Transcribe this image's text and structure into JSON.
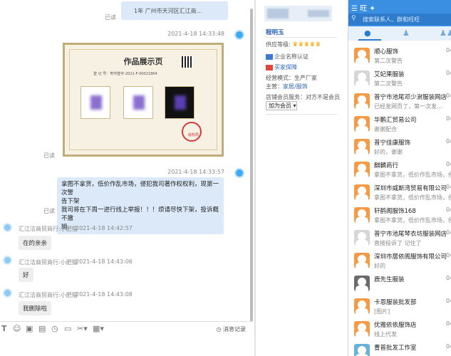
{
  "chat": {
    "top_card_text": "1年 广州市天河区汇江商…",
    "read_label": "已读",
    "messages": [
      {
        "time": "2021-4-18 14:33:48",
        "read": "已读"
      },
      {
        "time": "2021-4-18 14:33:57",
        "read": "已读",
        "text_lines": [
          "拿图不拿货，低价作乱市场，侵犯我司著作权权利，现第一次警",
          "告下架",
          "我司将在下周一进行线上举报！！！烦请尽快下架，投诉概不撤",
          "销"
        ]
      }
    ],
    "incoming": [
      {
        "sender": "汇江洁商贸商行:小肥猫",
        "time": "2021-4-18 14:42:57",
        "text": "在的亲亲"
      },
      {
        "sender": "汇江洁商贸商行:小肥猫",
        "time": "2021-4-18 14:43:06",
        "text": "好"
      },
      {
        "sender": "汇江洁商贸商行:小肥猫",
        "time": "2021-4-18 14:43:08",
        "text": "我删除啦"
      }
    ],
    "certificate": {
      "title": "作品展示页",
      "sub": "登 记 号：粤作登字-2021-F-00021864",
      "seal": "版权局"
    },
    "history_label": "消息记录"
  },
  "info": {
    "name": "程明玉",
    "level_label": "供应等级:",
    "enterprise": "企业名称认证",
    "buyer_protect": "买家保障",
    "model": "经营模式：生产厂家",
    "main_label": "主营：",
    "main_links": "家居/服饰",
    "member": "店铺会员服务：对方不是会员",
    "upgrade": "加为会员"
  },
  "right": {
    "search_placeholder": "搜索联系人、群和旺旺",
    "contacts": [
      {
        "name": "顺心服饰",
        "snippet": "第二次警告",
        "date": "04-"
      },
      {
        "name": "艾妃果服装",
        "snippet": "第二次警告",
        "date": "04-"
      },
      {
        "name": "普宁市池尾邓少澍服装网店",
        "snippet": "已经发网页了，第一次发…",
        "date": "04-"
      },
      {
        "name": "华鹏汇贸易公司",
        "snippet": "谢谢配合",
        "date": "04-"
      },
      {
        "name": "普宁佳康服饰",
        "snippet": "好的，谢谢",
        "date": "04-"
      },
      {
        "name": "麒麟商行",
        "snippet": "拿图不拿货，低价作乱市场，侵犯…",
        "date": "04-"
      },
      {
        "name": "深圳市威斯湾贸易有限公司",
        "snippet": "拿图不拿货，低价作乱市场，侵犯…",
        "date": "04-"
      },
      {
        "name": "轩鹤阁服饰168",
        "snippet": "拿图不拿货，低价作乱市场，侵犯…",
        "date": "04-"
      },
      {
        "name": "普宁市池尾琴衣坊服装网店",
        "snippet": "直接投诉了 记住了",
        "date": "04-"
      },
      {
        "name": "深圳市居依阁服饰有限公司",
        "snippet": "好的",
        "date": "04-"
      },
      {
        "name": "鹿先生服装",
        "snippet": "",
        "date": "04-"
      },
      {
        "name": "卡恩服装批发部",
        "snippet": "[图片]",
        "date": "04-"
      },
      {
        "name": "优雅依依服饰店",
        "snippet": "线上代发",
        "date": "04-"
      },
      {
        "name": "曹普批发工作室",
        "snippet": "",
        "date": "04-"
      }
    ]
  }
}
